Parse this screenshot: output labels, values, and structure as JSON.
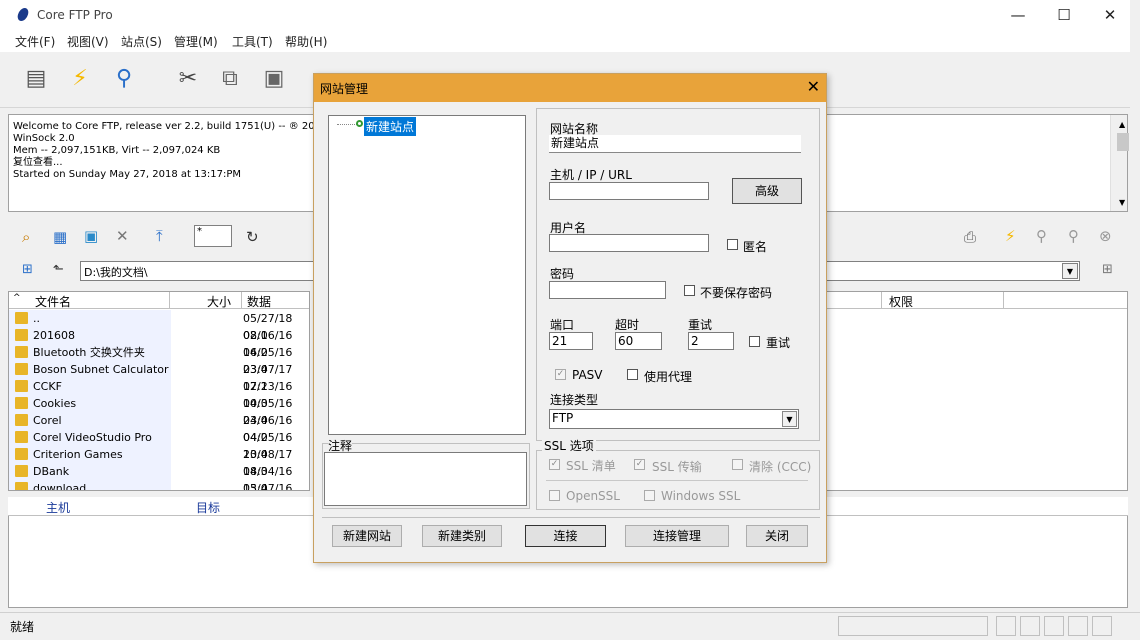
{
  "app": {
    "title": "Core FTP Pro"
  },
  "window_controls": {
    "minimize": "—",
    "maximize": "☐",
    "close": "✕"
  },
  "menu": [
    "文件(F)",
    "视图(V)",
    "站点(S)",
    "管理(M)",
    "工具(T)",
    "帮助(H)"
  ],
  "log": {
    "lines": [
      "Welcome to Core FTP, release ver 2.2, build 1751(U) -- ® 2003-20",
      "WinSock 2.0",
      "Mem -- 2,097,151KB, Virt -- 2,097,024 KB",
      "复位查看...",
      "Started on Sunday May 27, 2018 at 13:17:PM"
    ]
  },
  "local": {
    "filter": "*",
    "path": "D:\\我的文档\\",
    "columns": {
      "name": "文件名",
      "size": "大小",
      "date": "数据"
    },
    "files": [
      {
        "name": "..",
        "date": "05/27/18 02:0"
      },
      {
        "name": "201608",
        "date": "08/16/16 16:2"
      },
      {
        "name": "Bluetooth 交换文件夹",
        "date": "04/05/16 23:4"
      },
      {
        "name": "Boson Subnet Calculator",
        "date": "03/07/17 17:2"
      },
      {
        "name": "CCKF",
        "date": "02/13/16 10:3"
      },
      {
        "name": "Cookies",
        "date": "04/05/16 23:4"
      },
      {
        "name": "Corel",
        "date": "04/06/16 04:2"
      },
      {
        "name": "Corel VideoStudio Pro",
        "date": "04/05/16 23:4"
      },
      {
        "name": "Criterion Games",
        "date": "10/08/17 18:3"
      },
      {
        "name": "DBank",
        "date": "04/04/16 15:4"
      },
      {
        "name": "download",
        "date": "03/07/16 14:3"
      }
    ]
  },
  "remote": {
    "columns": {
      "perm": "权限"
    }
  },
  "transfer": {
    "columns": {
      "host": "主机",
      "target": "目标"
    }
  },
  "status": {
    "text": "就绪"
  },
  "dialog": {
    "title": "网站管理",
    "tree_item": "新建站点",
    "notes_label": "注释",
    "site_name_label": "网站名称",
    "site_name_value": "新建站点",
    "host_label": "主机 / IP / URL",
    "advanced_button": "高级",
    "username_label": "用户名",
    "anonymous_label": "匿名",
    "password_label": "密码",
    "dont_save_pw_label": "不要保存密码",
    "port_label": "端口",
    "port_value": "21",
    "timeout_label": "超时",
    "timeout_value": "60",
    "retry_label": "重试",
    "retry_value": "2",
    "retry_check_label": "重试",
    "pasv_label": "PASV",
    "proxy_label": "使用代理",
    "conn_type_label": "连接类型",
    "conn_type_value": "FTP",
    "ssl_group_label": "SSL 选项",
    "ssl_list_label": "SSL 清单",
    "ssl_transfer_label": "SSL 传输",
    "clear_ccc_label": "清除 (CCC)",
    "openssl_label": "OpenSSL",
    "windows_ssl_label": "Windows SSL",
    "buttons": {
      "new_site": "新建网站",
      "new_category": "新建类别",
      "connect": "连接",
      "conn_manage": "连接管理",
      "close": "关闭"
    }
  }
}
